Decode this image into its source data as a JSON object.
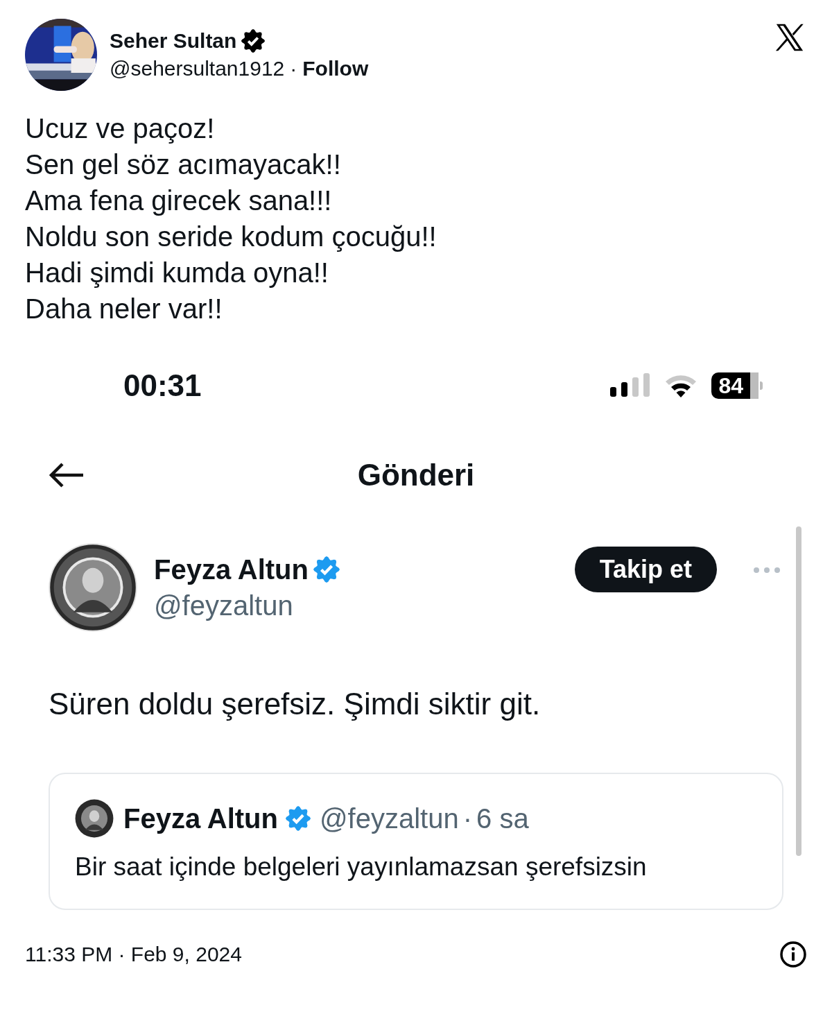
{
  "author": {
    "name": "Seher Sultan",
    "verified": true,
    "handle": "@sehersultan1912",
    "separator": "·",
    "follow": "Follow"
  },
  "text_lines": [
    "Ucuz ve paçoz!",
    "Sen gel söz acımayacak!!",
    "Ama fena girecek sana!!!",
    "Noldu son seride kodum çocuğu!!",
    "Hadi şimdi kumda oyna!!",
    "Daha neler var!!"
  ],
  "screenshot": {
    "status_bar": {
      "time": "00:31",
      "battery": "84"
    },
    "nav": {
      "title": "Gönderi"
    },
    "post": {
      "name": "Feyza Altun",
      "verified": true,
      "handle": "@feyzaltun",
      "follow_button": "Takip et",
      "text": "Süren doldu şerefsiz. Şimdi siktir git.",
      "quote": {
        "name": "Feyza Altun",
        "verified": true,
        "handle": "@feyzaltun",
        "separator": "·",
        "time": "6 sa",
        "text": "Bir saat içinde belgeleri yayınlamazsan şerefsizsin"
      }
    }
  },
  "timestamp": "11:33 PM · Feb 9, 2024"
}
